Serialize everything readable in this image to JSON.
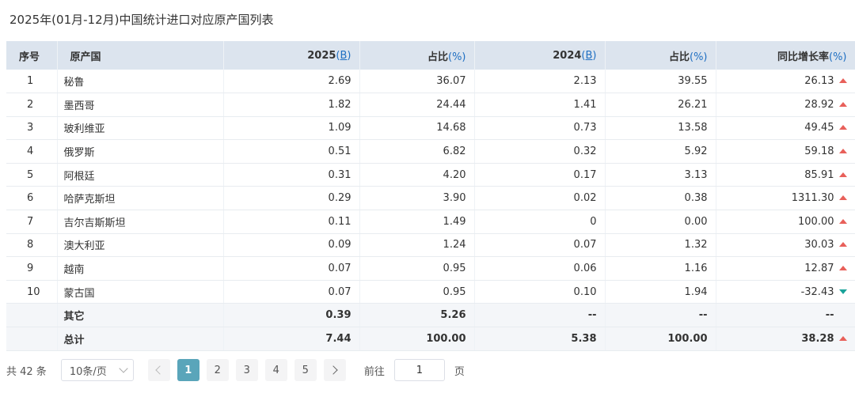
{
  "title": "2025年(01月-12月)中国统计进口对应原产国列表",
  "columns": {
    "idx": "序号",
    "country": "原产国",
    "v2025_year": "2025",
    "v2025_unit": "B",
    "p2025_label": "占比",
    "p2025_unit": "%",
    "v2024_year": "2024",
    "v2024_unit": "B",
    "p2024_label": "占比",
    "p2024_unit": "%",
    "yoy_label": "同比增长率",
    "yoy_unit": "%"
  },
  "rows": [
    {
      "idx": "1",
      "country": "秘鲁",
      "v2025": "2.69",
      "p2025": "36.07",
      "v2024": "2.13",
      "p2024": "39.55",
      "yoy": "26.13",
      "trend": "up"
    },
    {
      "idx": "2",
      "country": "墨西哥",
      "v2025": "1.82",
      "p2025": "24.44",
      "v2024": "1.41",
      "p2024": "26.21",
      "yoy": "28.92",
      "trend": "up"
    },
    {
      "idx": "3",
      "country": "玻利维亚",
      "v2025": "1.09",
      "p2025": "14.68",
      "v2024": "0.73",
      "p2024": "13.58",
      "yoy": "49.45",
      "trend": "up"
    },
    {
      "idx": "4",
      "country": "俄罗斯",
      "v2025": "0.51",
      "p2025": "6.82",
      "v2024": "0.32",
      "p2024": "5.92",
      "yoy": "59.18",
      "trend": "up"
    },
    {
      "idx": "5",
      "country": "阿根廷",
      "v2025": "0.31",
      "p2025": "4.20",
      "v2024": "0.17",
      "p2024": "3.13",
      "yoy": "85.91",
      "trend": "up"
    },
    {
      "idx": "6",
      "country": "哈萨克斯坦",
      "v2025": "0.29",
      "p2025": "3.90",
      "v2024": "0.02",
      "p2024": "0.38",
      "yoy": "1311.30",
      "trend": "up"
    },
    {
      "idx": "7",
      "country": "吉尔吉斯斯坦",
      "v2025": "0.11",
      "p2025": "1.49",
      "v2024": "0",
      "p2024": "0.00",
      "yoy": "100.00",
      "trend": "up"
    },
    {
      "idx": "8",
      "country": "澳大利亚",
      "v2025": "0.09",
      "p2025": "1.24",
      "v2024": "0.07",
      "p2024": "1.32",
      "yoy": "30.03",
      "trend": "up"
    },
    {
      "idx": "9",
      "country": "越南",
      "v2025": "0.07",
      "p2025": "0.95",
      "v2024": "0.06",
      "p2024": "1.16",
      "yoy": "12.87",
      "trend": "up"
    },
    {
      "idx": "10",
      "country": "蒙古国",
      "v2025": "0.07",
      "p2025": "0.95",
      "v2024": "0.10",
      "p2024": "1.94",
      "yoy": "-32.43",
      "trend": "down"
    }
  ],
  "other_row": {
    "label": "其它",
    "v2025": "0.39",
    "p2025": "5.26",
    "v2024": "--",
    "p2024": "--",
    "yoy": "--"
  },
  "total_row": {
    "label": "总计",
    "v2025": "7.44",
    "p2025": "100.00",
    "v2024": "5.38",
    "p2024": "100.00",
    "yoy": "38.28",
    "trend": "up"
  },
  "pagination": {
    "total_text": "共 42 条",
    "page_size": "10条/页",
    "pages": [
      "1",
      "2",
      "3",
      "4",
      "5"
    ],
    "current_page": "1",
    "goto_label": "前往",
    "goto_value": "1",
    "page_suffix": "页"
  },
  "colors": {
    "up": "#e8605a",
    "down": "#1aa39a",
    "header_bg": "#dce4ee",
    "active_page": "#5aa5ba"
  },
  "icons": {
    "up": "triangle-up-icon",
    "down": "triangle-down-icon",
    "prev": "chevron-left-icon",
    "next": "chevron-right-icon",
    "select": "chevron-down-icon"
  }
}
